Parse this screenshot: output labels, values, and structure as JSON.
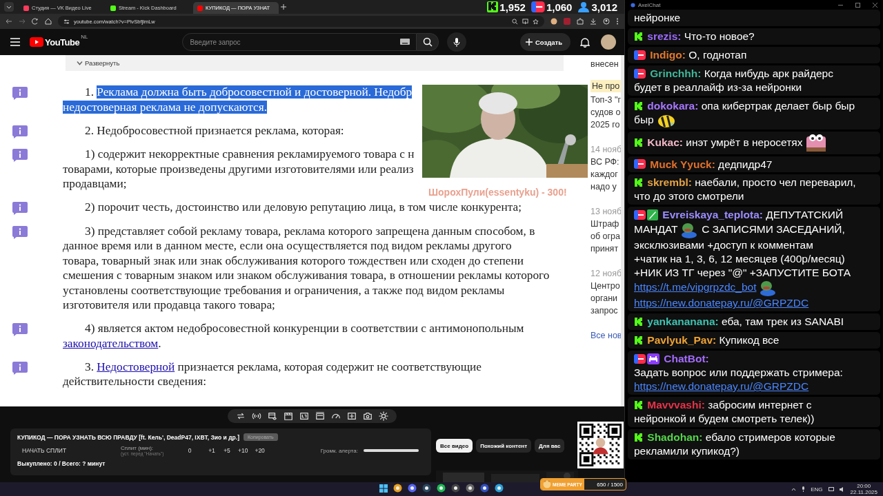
{
  "browser": {
    "tabs": [
      {
        "title": "Студия — VK Видео Live",
        "selected": false
      },
      {
        "title": "Stream - Kick Dashboard",
        "selected": false
      },
      {
        "title": "КУПИКОД — ПОРА УЗНАТ",
        "selected": true
      }
    ],
    "address": "youtube.com/watch?v=PivSbfjlmLw"
  },
  "stream_stats": [
    {
      "kind": "kick",
      "value": "1,952"
    },
    {
      "kind": "live",
      "value": "1,060"
    },
    {
      "kind": "viewers",
      "value": "3,012"
    }
  ],
  "youtube": {
    "logo": "YouTube",
    "region": "NL",
    "search": {
      "placeholder": "Введите запрос"
    },
    "create_button": "Создать"
  },
  "document": {
    "expand_button": "Развернуть",
    "paragraphs": [
      {
        "lines": [
          [
            {
              "kind": "plain",
              "text": "1. "
            },
            {
              "kind": "selected",
              "text": "Реклама должна быть добросовестной и достоверной. Недобр"
            }
          ],
          [
            {
              "kind": "selected",
              "text": "недостоверная реклама не допускаются."
            }
          ]
        ]
      },
      {
        "lines": [
          [
            {
              "kind": "plain",
              "text": "2. Недобросовестной признается реклама, которая:"
            }
          ]
        ]
      },
      {
        "lines": [
          [
            {
              "kind": "plain",
              "text": "1) содержит некорректные сравнения рекламируемого товара с н"
            }
          ],
          [
            {
              "kind": "plain",
              "text": "товарами, которые произведены другими изготовителями или реализ"
            }
          ],
          [
            {
              "kind": "plain",
              "text": "продавцами;"
            }
          ]
        ]
      },
      {
        "lines": [
          [
            {
              "kind": "plain",
              "text": "2) порочит честь, достоинство или деловую репутацию лица, в том числе конкурента;"
            }
          ]
        ]
      },
      {
        "lines": [
          [
            {
              "kind": "plain",
              "text": "3) представляет собой рекламу товара, реклама которого запрещена данным способом, в"
            }
          ],
          [
            {
              "kind": "plain",
              "text": "данное время или в данном месте, если она осуществляется под видом рекламы другого"
            }
          ],
          [
            {
              "kind": "plain",
              "text": "товара, товарный знак или знак обслуживания которого тождествен или сходен до степени"
            }
          ],
          [
            {
              "kind": "plain",
              "text": "смешения с товарным знаком или знаком обслуживания товара, в отношении рекламы которого"
            }
          ],
          [
            {
              "kind": "plain",
              "text": "установлены соответствующие требования и ограничения, а также под видом рекламы"
            }
          ],
          [
            {
              "kind": "plain",
              "text": "изготовителя или продавца такого товара;"
            }
          ]
        ]
      },
      {
        "lines": [
          [
            {
              "kind": "plain",
              "text": "4) является актом недобросовестной конкуренции в соответствии с антимонопольным"
            }
          ],
          [
            {
              "kind": "link",
              "text": "законодательством"
            },
            {
              "kind": "plain",
              "text": "."
            }
          ]
        ]
      },
      {
        "lines": [
          [
            {
              "kind": "plain",
              "text": "3. "
            },
            {
              "kind": "link",
              "text": "Недостоверной"
            },
            {
              "kind": "plain",
              "text": " признается реклама, которая содержит не соответствующие"
            }
          ],
          [
            {
              "kind": "plain",
              "text": "действительности сведения:"
            }
          ]
        ]
      }
    ]
  },
  "donation_alert": "ШорохПули(essentyku) - 300!",
  "news": {
    "top_line": "внесен",
    "items": [
      {
        "badge": "Не про",
        "lines": [
          "Топ-3 \"г",
          "судов о",
          "2025 го"
        ]
      },
      {
        "date": "14 нояб",
        "lines": [
          "ВС РФ:",
          "каждог",
          "надо у"
        ]
      },
      {
        "date": "13 нояб",
        "lines": [
          "Штраф",
          "об огра",
          "принят"
        ]
      },
      {
        "date": "12 нояб",
        "lines": [
          "Центро",
          "органи",
          "запрос"
        ]
      }
    ],
    "more_link": "Все нов"
  },
  "control_panel": {
    "title": "КУПИКОД — ПОРА УЗНАТЬ ВСЮ ПРАВДУ [ft. Кель', DeadP47, IXBT, Зио и др.]",
    "copy_button": "Копировать",
    "start_button": "НАЧАТЬ СПЛИТ",
    "split_label": "Сплит (мин):",
    "split_hint": "(уст. перед \"Начать\")",
    "split_value": "0",
    "increments": [
      "+1",
      "+5",
      "+10",
      "+20"
    ],
    "volume_label": "Громк. алерта:",
    "volume": {
      "level": 1
    },
    "summary": "Выкуплено: 0 / Всего: ? минут"
  },
  "chips": [
    {
      "label": "Все видео",
      "selected": true
    },
    {
      "label": "Похожий контент",
      "selected": false
    },
    {
      "label": "Для вас",
      "selected": false
    }
  ],
  "meme_party": {
    "title": "MEME PARTY",
    "progress": "650 / 1500"
  },
  "chat": {
    "title": "AxelChat",
    "messages": [
      {
        "lines": [
          [
            {
              "kind": "text",
              "text": "нейронке"
            }
          ]
        ]
      },
      {
        "badges": [
          {
            "kind": "kick"
          }
        ],
        "author": "srezis:",
        "color": "#9d6cff",
        "lines": [
          [
            {
              "kind": "text",
              "text": "Что-то новое?"
            }
          ]
        ]
      },
      {
        "badges": [
          {
            "kind": "live"
          }
        ],
        "author": "Indigo:",
        "color": "#e0782e",
        "lines": [
          [
            {
              "kind": "text",
              "text": "О, годнотап"
            }
          ]
        ]
      },
      {
        "badges": [
          {
            "kind": "live"
          }
        ],
        "author": "Grinchhh:",
        "color": "#3fb79a",
        "lines": [
          [
            {
              "kind": "text",
              "text": "Когда нибудь арк райдерс"
            }
          ],
          [
            {
              "kind": "text",
              "text": "будет в реаллайф из-за нейронки"
            }
          ]
        ]
      },
      {
        "badges": [
          {
            "kind": "kick"
          }
        ],
        "author": "dokokara:",
        "color": "#a777ff",
        "lines": [
          [
            {
              "kind": "text",
              "text": "опа кибертрак делает быр быр"
            }
          ],
          [
            {
              "kind": "text",
              "text": "быр"
            },
            {
              "kind": "emote"
            }
          ]
        ]
      },
      {
        "badges": [
          {
            "kind": "kick"
          }
        ],
        "author": "Kukac:",
        "color": "#f2b8c8",
        "lines": [
          [
            {
              "kind": "text",
              "text": "инэт умрёт в неросетях"
            },
            {
              "kind": "emote"
            }
          ]
        ]
      },
      {
        "badges": [
          {
            "kind": "live"
          }
        ],
        "author": "Muck Yyuck:",
        "color": "#e0702c",
        "lines": [
          [
            {
              "kind": "text",
              "text": "дедпидр47"
            }
          ]
        ]
      },
      {
        "badges": [
          {
            "kind": "kick"
          }
        ],
        "author": "skrembl:",
        "color": "#e5a346",
        "lines": [
          [
            {
              "kind": "text",
              "text": "наебали, просто чел переварил,"
            }
          ],
          [
            {
              "kind": "text",
              "text": "что до этого смотрели"
            }
          ]
        ]
      },
      {
        "badges": [
          {
            "kind": "live"
          },
          {
            "kind": "moderator"
          }
        ],
        "author": "Evreiskaya_teplota:",
        "color": "#9b8dff",
        "lines": [
          [
            {
              "kind": "text",
              "text": "ДЕПУТАТСКИЙ"
            }
          ],
          [
            {
              "kind": "text",
              "text": "МАНДАТ"
            },
            {
              "kind": "emote"
            },
            {
              "kind": "text",
              "text": "С ЗАПИСЯМИ ЗАСЕДАНИЙ,"
            }
          ],
          [
            {
              "kind": "text",
              "text": "эксклюзивами +доступ к комментам"
            }
          ],
          [
            {
              "kind": "text",
              "text": "+чатик на 1, 3, 6, 12 месяцев (400р/месяц)"
            }
          ],
          [
            {
              "kind": "text",
              "text": "+НИК ИЗ ТГ через \"@\" +ЗАПУСТИТЕ БОТА"
            }
          ],
          [
            {
              "kind": "link",
              "text": "https://t.me/vipgrpzdc_bot"
            },
            {
              "kind": "emote"
            }
          ],
          [
            {
              "kind": "link",
              "text": "https://new.donatepay.ru/@GRPZDC"
            }
          ]
        ]
      },
      {
        "badges": [
          {
            "kind": "kick"
          }
        ],
        "author": "yankananana:",
        "color": "#3fc1b0",
        "lines": [
          [
            {
              "kind": "text",
              "text": "еба, там трек из SANABI"
            }
          ]
        ]
      },
      {
        "badges": [
          {
            "kind": "kick"
          }
        ],
        "author": "Pavlyuk_Pav:",
        "color": "#f0a332",
        "lines": [
          [
            {
              "kind": "text",
              "text": "Купикод все"
            }
          ]
        ]
      },
      {
        "kind": "stacked",
        "badges": [
          {
            "kind": "live"
          },
          {
            "kind": "bot"
          }
        ],
        "author": "ChatBot:",
        "color": "#a46cff",
        "lines": [
          [
            {
              "kind": "text",
              "text": "Задать вопрос или поддержать стримера:"
            }
          ],
          [
            {
              "kind": "link",
              "text": "https://new.donatepay.ru/@GRPZDC"
            }
          ]
        ]
      },
      {
        "badges": [
          {
            "kind": "kick"
          }
        ],
        "author": "Mavvvashi:",
        "color": "#e6334a",
        "lines": [
          [
            {
              "kind": "text",
              "text": "забросим интернет с"
            }
          ],
          [
            {
              "kind": "text",
              "text": "нейронкой и будем смотреть телек))"
            }
          ]
        ]
      },
      {
        "badges": [
          {
            "kind": "kick"
          }
        ],
        "author": "Shadohan:",
        "color": "#55d64a",
        "lines": [
          [
            {
              "kind": "text",
              "text": "ебало стримеров которые"
            }
          ],
          [
            {
              "kind": "text",
              "text": "рекламили купикод?)"
            }
          ]
        ]
      }
    ]
  },
  "taskbar": {
    "language": "ENG",
    "time": "20:00",
    "date": "22.11.2025"
  }
}
